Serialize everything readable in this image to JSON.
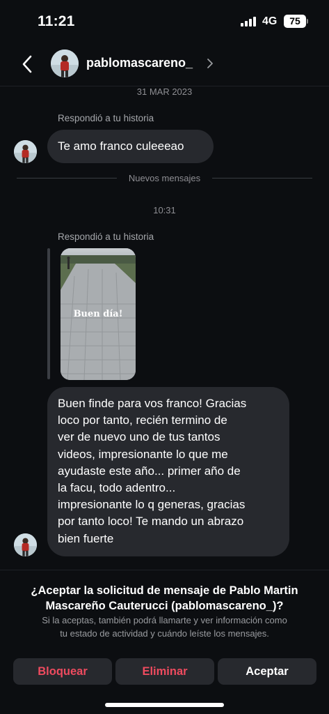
{
  "status_bar": {
    "time": "11:21",
    "network": "4G",
    "battery": "75"
  },
  "header": {
    "username": "pablomascareno_",
    "icons": [
      "back-arrow-icon",
      "avatar",
      "chevron-right-icon"
    ]
  },
  "conversation": {
    "date_1": "31 MAR 2023",
    "reply_label_1": "Respondió a tu historia",
    "message_1": "Te amo franco culeeeao",
    "new_messages_label": "Nuevos mensajes",
    "time_2": "10:31",
    "reply_label_2": "Respondió a tu historia",
    "story_text": "Buen día!",
    "message_2_lines": [
      "Buen finde para vos franco! Gracias",
      "loco por tanto, recién termino de",
      "ver de nuevo uno de tus tantos",
      "videos, impresionante lo que me",
      "ayudaste este año... primer año de",
      "la facu, todo adentro...",
      "impresionante lo q generas, gracias",
      "por tanto loco! Te mando un abrazo",
      "bien fuerte"
    ]
  },
  "request": {
    "title_line_1": "¿Aceptar la solicitud de mensaje de Pablo Martin",
    "title_line_2": "Mascareño Cauterucci (pablomascareno_)?",
    "desc_line_1": "Si la aceptas, también podrá llamarte y ver información como",
    "desc_line_2": "tu estado de actividad y cuándo leíste los mensajes.",
    "block_label": "Bloquear",
    "delete_label": "Eliminar",
    "accept_label": "Aceptar"
  },
  "colors": {
    "background": "#0c0e11",
    "bubble": "#27292e",
    "destructive": "#ef4b5f",
    "secondary_text": "#8e8e93"
  }
}
